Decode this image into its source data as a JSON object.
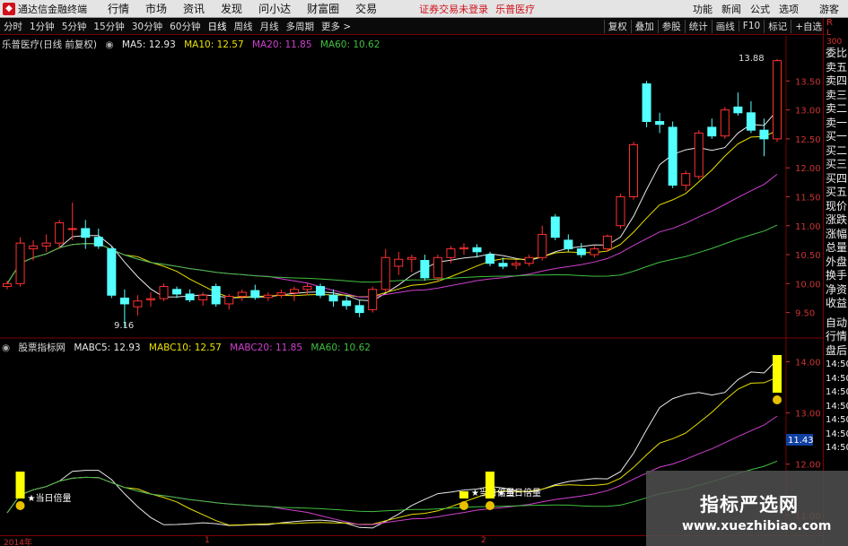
{
  "window": {
    "app_title": "通达信金融终端",
    "menu": [
      "行情",
      "市场",
      "资讯",
      "发现",
      "问小达",
      "财富圈",
      "交易"
    ],
    "status_notice": "证券交易未登录",
    "stock_name_header": "乐普医疗",
    "right_menu": [
      "功能",
      "新闻",
      "公式",
      "选项"
    ],
    "guest": "游客"
  },
  "toolbar": {
    "periods": [
      "分时",
      "1分钟",
      "5分钟",
      "15分钟",
      "30分钟",
      "60分钟",
      "日线",
      "周线",
      "月线",
      "多周期",
      "更多 >"
    ],
    "active_period": "日线",
    "right_buttons": [
      "复权",
      "叠加",
      "参股",
      "统计",
      "画线",
      "F10",
      "标记",
      "+自选"
    ]
  },
  "main_chart": {
    "title": "乐普医疗(日线 前复权)",
    "legend": [
      {
        "label": "MA5: 12.93",
        "color": "#e8e8e8"
      },
      {
        "label": "MA10: 12.57",
        "color": "#e8e000"
      },
      {
        "label": "MA20: 11.85",
        "color": "#d040d0"
      },
      {
        "label": "MA60: 10.62",
        "color": "#40c040"
      }
    ],
    "high_label": "13.88",
    "low_label": "9.16",
    "y_ticks": [
      "13.50",
      "13.00",
      "12.50",
      "12.00",
      "11.50",
      "11.00",
      "10.50",
      "10.00",
      "9.50"
    ]
  },
  "sub_chart": {
    "title": "股票指标网",
    "legend": [
      {
        "label": "MABC5: 12.93",
        "color": "#e8e8e8"
      },
      {
        "label": "MABC10: 12.57",
        "color": "#e8e000"
      },
      {
        "label": "MABC20: 11.85",
        "color": "#d040d0"
      },
      {
        "label": "MA60: 10.62",
        "color": "#40c040"
      }
    ],
    "y_ticks": [
      "14.00",
      "13.00",
      "12.00",
      "11.00"
    ],
    "current_value": "11.43",
    "signal_label": "★当日倍量"
  },
  "right_panel": {
    "top": [
      "L",
      "R"
    ],
    "top_small": "300",
    "items": [
      "委比",
      "卖五",
      "卖四",
      "卖三",
      "卖二",
      "卖一",
      "买一",
      "买二",
      "买三",
      "买四",
      "买五",
      "现价",
      "涨跌",
      "涨幅",
      "总量",
      "外盘",
      "换手",
      "净资",
      "收益"
    ],
    "items2": [
      "自动",
      "行情",
      "盘后",
      "14:50",
      "14:50",
      "14:50",
      "14:50",
      "14:50",
      "14:50",
      "14:50"
    ]
  },
  "x_axis": [
    "2014年",
    "1",
    "2"
  ],
  "watermark": {
    "line1": "指标严选网",
    "line2": "www.xuezhibiao.com"
  },
  "chart_data": {
    "type": "candlestick",
    "candles": [
      {
        "o": 9.95,
        "h": 10.05,
        "l": 9.9,
        "c": 10.0
      },
      {
        "o": 10.0,
        "h": 10.8,
        "l": 9.95,
        "c": 10.7
      },
      {
        "o": 10.6,
        "h": 10.75,
        "l": 10.4,
        "c": 10.65
      },
      {
        "o": 10.65,
        "h": 10.85,
        "l": 10.55,
        "c": 10.7
      },
      {
        "o": 10.7,
        "h": 11.1,
        "l": 10.6,
        "c": 11.05
      },
      {
        "o": 10.95,
        "h": 11.4,
        "l": 10.75,
        "c": 10.95
      },
      {
        "o": 10.95,
        "h": 11.1,
        "l": 10.6,
        "c": 10.8
      },
      {
        "o": 10.8,
        "h": 10.95,
        "l": 10.6,
        "c": 10.65
      },
      {
        "o": 10.6,
        "h": 10.65,
        "l": 9.75,
        "c": 9.8
      },
      {
        "o": 9.75,
        "h": 9.9,
        "l": 9.25,
        "c": 9.65
      },
      {
        "o": 9.6,
        "h": 9.8,
        "l": 9.45,
        "c": 9.7
      },
      {
        "o": 9.72,
        "h": 9.85,
        "l": 9.6,
        "c": 9.74
      },
      {
        "o": 9.74,
        "h": 10.0,
        "l": 9.7,
        "c": 9.95
      },
      {
        "o": 9.9,
        "h": 9.95,
        "l": 9.75,
        "c": 9.82
      },
      {
        "o": 9.82,
        "h": 9.9,
        "l": 9.68,
        "c": 9.72
      },
      {
        "o": 9.72,
        "h": 9.85,
        "l": 9.62,
        "c": 9.8
      },
      {
        "o": 9.95,
        "h": 10.0,
        "l": 9.6,
        "c": 9.65
      },
      {
        "o": 9.65,
        "h": 9.82,
        "l": 9.55,
        "c": 9.78
      },
      {
        "o": 9.78,
        "h": 9.9,
        "l": 9.7,
        "c": 9.85
      },
      {
        "o": 9.88,
        "h": 9.98,
        "l": 9.72,
        "c": 9.76
      },
      {
        "o": 9.76,
        "h": 9.85,
        "l": 9.7,
        "c": 9.8
      },
      {
        "o": 9.8,
        "h": 9.9,
        "l": 9.75,
        "c": 9.84
      },
      {
        "o": 9.84,
        "h": 9.95,
        "l": 9.7,
        "c": 9.9
      },
      {
        "o": 9.9,
        "h": 10.0,
        "l": 9.8,
        "c": 9.95
      },
      {
        "o": 9.95,
        "h": 10.0,
        "l": 9.75,
        "c": 9.8
      },
      {
        "o": 9.8,
        "h": 9.9,
        "l": 9.6,
        "c": 9.7
      },
      {
        "o": 9.7,
        "h": 9.8,
        "l": 9.55,
        "c": 9.62
      },
      {
        "o": 9.62,
        "h": 9.72,
        "l": 9.42,
        "c": 9.5
      },
      {
        "o": 9.55,
        "h": 9.95,
        "l": 9.5,
        "c": 9.9
      },
      {
        "o": 9.9,
        "h": 10.6,
        "l": 9.85,
        "c": 10.45
      },
      {
        "o": 10.3,
        "h": 10.55,
        "l": 10.15,
        "c": 10.42
      },
      {
        "o": 10.42,
        "h": 10.5,
        "l": 10.2,
        "c": 10.45
      },
      {
        "o": 10.4,
        "h": 10.5,
        "l": 10.05,
        "c": 10.1
      },
      {
        "o": 10.1,
        "h": 10.5,
        "l": 10.05,
        "c": 10.45
      },
      {
        "o": 10.45,
        "h": 10.65,
        "l": 10.35,
        "c": 10.6
      },
      {
        "o": 10.6,
        "h": 10.7,
        "l": 10.5,
        "c": 10.62
      },
      {
        "o": 10.62,
        "h": 10.68,
        "l": 10.45,
        "c": 10.55
      },
      {
        "o": 10.5,
        "h": 10.55,
        "l": 10.3,
        "c": 10.35
      },
      {
        "o": 10.35,
        "h": 10.45,
        "l": 10.25,
        "c": 10.3
      },
      {
        "o": 10.32,
        "h": 10.4,
        "l": 10.25,
        "c": 10.35
      },
      {
        "o": 10.35,
        "h": 10.5,
        "l": 10.3,
        "c": 10.45
      },
      {
        "o": 10.45,
        "h": 11.0,
        "l": 10.4,
        "c": 10.85
      },
      {
        "o": 11.15,
        "h": 11.2,
        "l": 10.75,
        "c": 10.8
      },
      {
        "o": 10.75,
        "h": 10.85,
        "l": 10.55,
        "c": 10.6
      },
      {
        "o": 10.6,
        "h": 10.7,
        "l": 10.45,
        "c": 10.5
      },
      {
        "o": 10.5,
        "h": 10.65,
        "l": 10.45,
        "c": 10.6
      },
      {
        "o": 10.6,
        "h": 10.85,
        "l": 10.55,
        "c": 10.82
      },
      {
        "o": 11.0,
        "h": 11.55,
        "l": 10.95,
        "c": 11.5
      },
      {
        "o": 11.5,
        "h": 12.45,
        "l": 11.45,
        "c": 12.4
      },
      {
        "o": 13.45,
        "h": 13.5,
        "l": 12.7,
        "c": 12.8
      },
      {
        "o": 12.8,
        "h": 12.95,
        "l": 12.6,
        "c": 12.75
      },
      {
        "o": 12.7,
        "h": 12.8,
        "l": 11.65,
        "c": 11.7
      },
      {
        "o": 11.7,
        "h": 11.95,
        "l": 11.6,
        "c": 11.9
      },
      {
        "o": 11.85,
        "h": 12.65,
        "l": 11.8,
        "c": 12.6
      },
      {
        "o": 12.7,
        "h": 12.85,
        "l": 12.5,
        "c": 12.55
      },
      {
        "o": 12.55,
        "h": 13.05,
        "l": 12.5,
        "c": 13.0
      },
      {
        "o": 13.05,
        "h": 13.3,
        "l": 12.9,
        "c": 12.95
      },
      {
        "o": 12.95,
        "h": 13.15,
        "l": 12.6,
        "c": 12.65
      },
      {
        "o": 12.65,
        "h": 12.85,
        "l": 12.2,
        "c": 12.5
      },
      {
        "o": 12.5,
        "h": 13.88,
        "l": 12.45,
        "c": 13.85
      }
    ],
    "price_range": [
      9.2,
      14.0
    ],
    "sub_range": [
      10.7,
      14.2
    ]
  }
}
